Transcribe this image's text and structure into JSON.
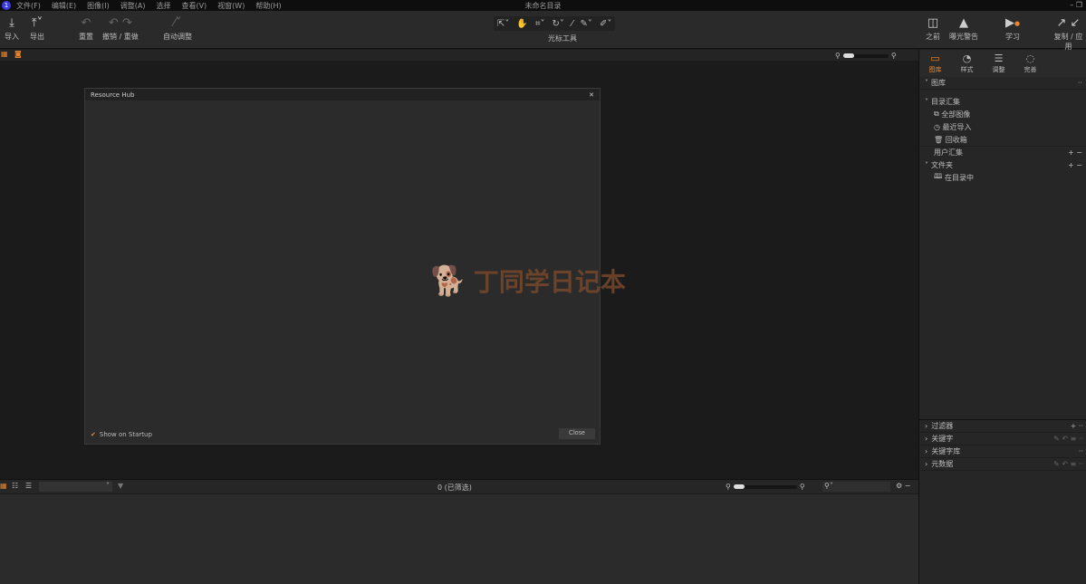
{
  "menu": [
    "文件(F)",
    "编辑(E)",
    "图像(I)",
    "调整(A)",
    "选择",
    "查看(V)",
    "视窗(W)",
    "帮助(H)"
  ],
  "window_title": "未命名目录",
  "toolbar": {
    "import": "导入",
    "export": "导出",
    "reset": "重置",
    "undo_redo": "撤销 / 重做",
    "auto_adjust": "自动调整",
    "cursor_tools": "光标工具",
    "before": "之前",
    "exposure_warning": "曝光警告",
    "learn": "学习",
    "copy_apply": "复制 / 应用"
  },
  "dialog": {
    "title": "Resource Hub",
    "show_on_startup": "Show on Startup",
    "close": "Close"
  },
  "watermark": "丁同学日记本",
  "right_tabs": [
    "图库",
    "样式",
    "调整",
    "完善"
  ],
  "library": {
    "title": "图库",
    "catalog_collections": "目录汇集",
    "items": [
      "全部图像",
      "最近导入",
      "回收箱"
    ],
    "user_collections": "用户汇集",
    "folders": "文件夹",
    "in_catalog": "在目录中"
  },
  "bottom_sections": [
    "过滤器",
    "关键字",
    "关键字库",
    "元数据"
  ],
  "browser": {
    "count": "0 (已筛选)"
  },
  "colors": {
    "accent": "#e8852d"
  }
}
